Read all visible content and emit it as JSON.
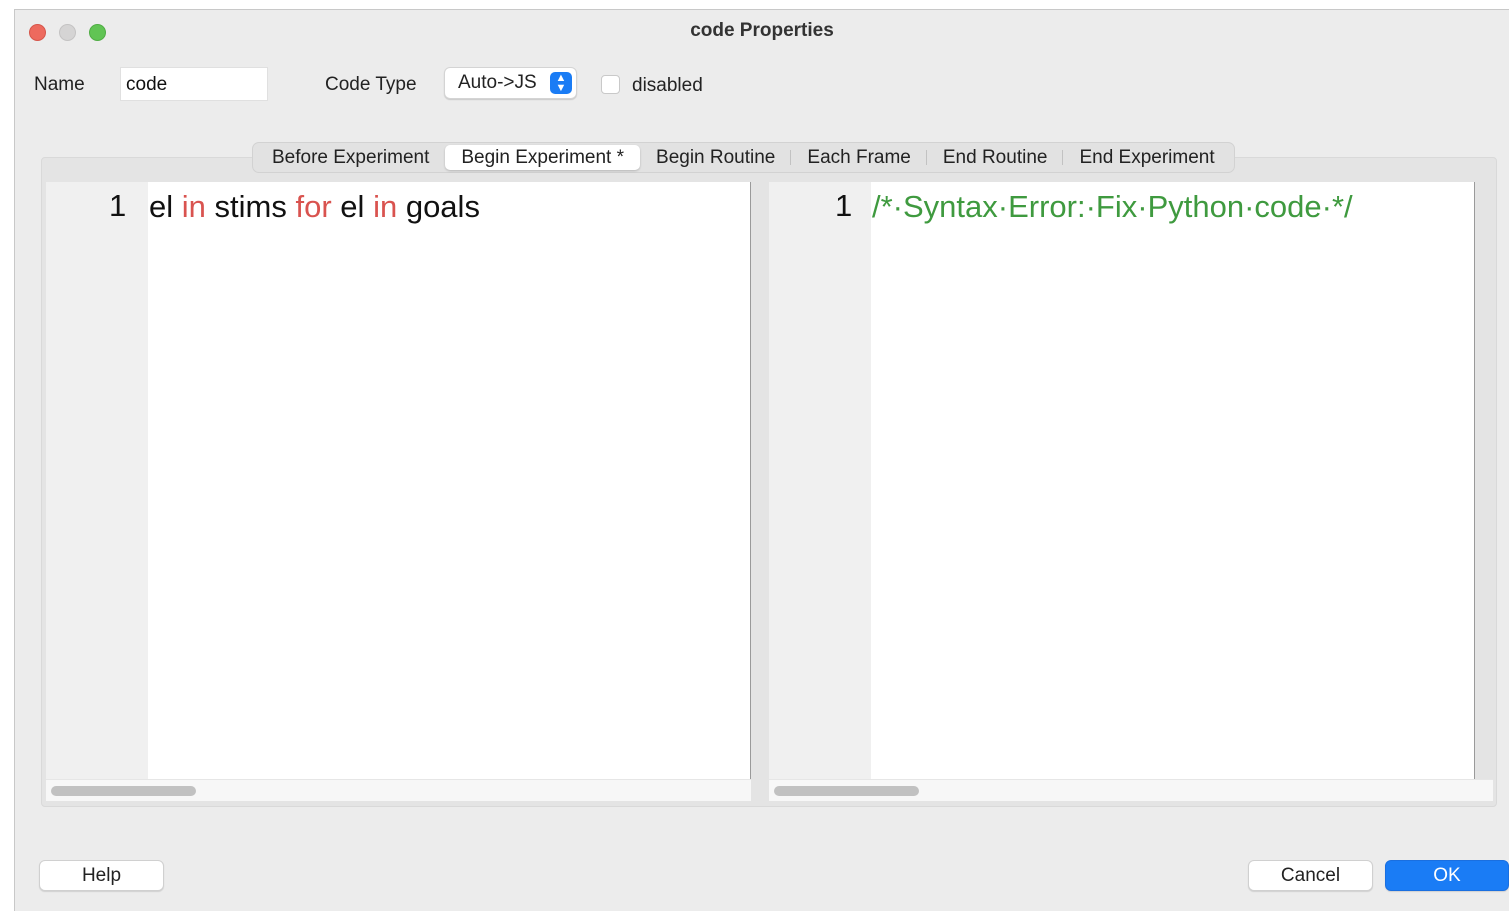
{
  "window": {
    "title": "code Properties"
  },
  "form": {
    "name_label": "Name",
    "name_value": "code",
    "code_type_label": "Code Type",
    "code_type_value": "Auto->JS",
    "disabled_label": "disabled",
    "disabled_checked": false
  },
  "tabs": [
    {
      "label": "Before Experiment",
      "active": false
    },
    {
      "label": "Begin Experiment *",
      "active": true
    },
    {
      "label": "Begin Routine",
      "active": false
    },
    {
      "label": "Each Frame",
      "active": false
    },
    {
      "label": "End Routine",
      "active": false
    },
    {
      "label": "End Experiment",
      "active": false
    }
  ],
  "python_editor": {
    "line_number": "1",
    "tokens": [
      "el",
      "in",
      "stims",
      "for",
      "el",
      "in",
      "goals"
    ]
  },
  "js_editor": {
    "line_number": "1",
    "text": "/*·Syntax·Error:·Fix·Python·code·*/"
  },
  "buttons": {
    "help": "Help",
    "cancel": "Cancel",
    "ok": "OK"
  },
  "colors": {
    "keyword": "#d9534f",
    "comment": "#3f9a3f",
    "accent": "#1a7cf5"
  }
}
